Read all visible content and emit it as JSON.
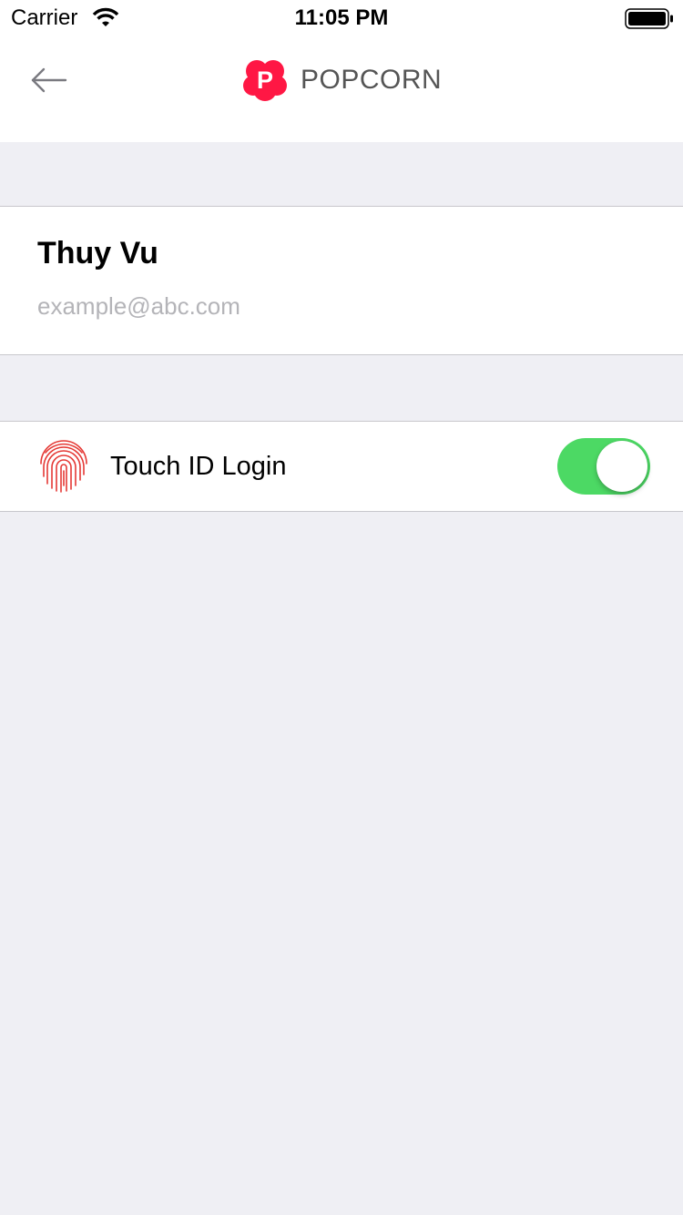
{
  "status_bar": {
    "carrier": "Carrier",
    "time": "11:05 PM",
    "wifi_icon": "wifi-icon",
    "battery_icon": "battery-full-icon"
  },
  "nav": {
    "back_icon": "arrow-left-icon",
    "logo_icon": "popcorn-logo",
    "logo_letter": "P",
    "title": "POPCORN"
  },
  "profile": {
    "name": "Thuy Vu",
    "email": "example@abc.com"
  },
  "settings": {
    "touch_id": {
      "icon": "fingerprint-icon",
      "label": "Touch ID Login",
      "enabled": true
    }
  },
  "colors": {
    "brand": "#ff1744",
    "toggle_on": "#4cd964",
    "background": "#efeff4",
    "fingerprint": "#e53935"
  }
}
